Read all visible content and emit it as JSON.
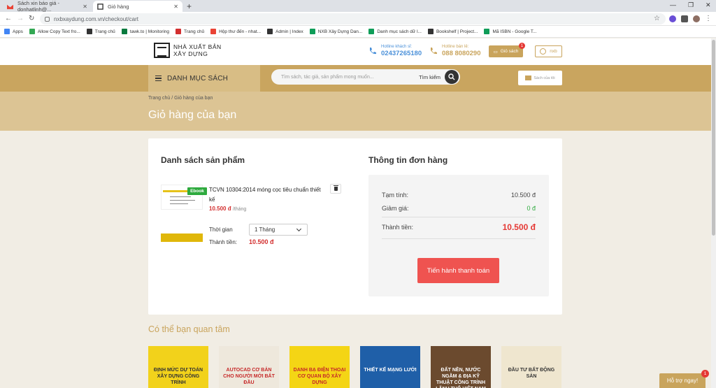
{
  "browser": {
    "tabs": [
      {
        "label": "Sách xin báo giá - donhatlinh@..."
      },
      {
        "label": "Giỏ hàng"
      }
    ],
    "url": "nxbxaydung.com.vn/checkout/cart",
    "bookmarks": [
      "Apps",
      "Allow Copy Text fro...",
      "Trang chủ",
      "tawk.to | Monitoring",
      "Trang chủ",
      "Hộp thư đến - nhat...",
      "Admin | Index",
      "NXB Xây Dựng Dan...",
      "Danh mục sách dữ l...",
      "Bookshelf | Project...",
      "Mã ISBN - Google T..."
    ]
  },
  "header": {
    "logo_line1": "NHÀ XUẤT BẢN",
    "logo_line2": "XÂY DỰNG",
    "hotline1_label": "Hotline khách sỉ:",
    "hotline1_number": "02437265180",
    "hotline2_label": "Hotline bán lẻ:",
    "hotline2_number": "088 8080290",
    "cart_label": "Giỏ sách",
    "cart_count": "1",
    "user_label": "nxb"
  },
  "nav": {
    "menu_label": "DANH MỤC SÁCH",
    "search_placeholder": "Tìm sách, tác giả, sản phẩm mong muốn...",
    "search_label": "Tìm kiếm",
    "bookshelf_label": "Sách của tôi"
  },
  "banner": {
    "breadcrumb": "Trang chủ / Giỏ hàng của bạn",
    "title": "Giỏ hàng của bạn"
  },
  "cart": {
    "heading": "Danh sách sản phẩm",
    "item": {
      "badge": "Ebook",
      "name": "TCVN 10304:2014 móng cọc tiêu chuẩn thiết kế",
      "price": "10.500 đ",
      "price_unit": "/tháng",
      "duration_label": "Thời gian",
      "duration_value": "1 Tháng",
      "subtotal_label": "Thành tiền:",
      "subtotal_value": "10.500 đ"
    }
  },
  "order": {
    "heading": "Thông tin đơn hàng",
    "subtotal_label": "Tạm tính:",
    "subtotal_value": "10.500 đ",
    "discount_label": "Giảm giá:",
    "discount_value": "0 đ",
    "total_label": "Thành tiền:",
    "total_value": "10.500 đ",
    "checkout_label": "Tiến hành thanh toán"
  },
  "suggestions": {
    "heading": "Có thể bạn quan tâm",
    "books": [
      {
        "title": "ĐỊNH MỨC DỰ TOÁN XÂY DỰNG CÔNG TRÌNH",
        "color": "#f2d21b",
        "text_color": "#333"
      },
      {
        "title": "AUTOCAD CƠ BẢN CHO NGƯỜI MỚI BẮT ĐẦU",
        "color": "#eee8dc",
        "text_color": "#c62828"
      },
      {
        "title": "DANH BẠ ĐIỆN THOẠI CƠ QUAN BỘ XÂY DỰNG",
        "color": "#f4d515",
        "text_color": "#c62828"
      },
      {
        "title": "THIẾT KẾ MẠNG LƯỚI",
        "color": "#1f5fa8",
        "text_color": "#ffffff"
      },
      {
        "title": "ĐẤT NỀN, NƯỚC NGẦM & ĐỊA KỸ THUẬT CÔNG TRÌNH LÃNH THỔ VIỆT NAM",
        "color": "#6b4a2e",
        "text_color": "#ffffff"
      },
      {
        "title": "ĐẦU TƯ BẤT ĐỘNG SẢN",
        "color": "#efe6cf",
        "text_color": "#333"
      }
    ]
  },
  "help": {
    "label": "Hỗ trợ ngay!",
    "count": "1"
  },
  "colors": {
    "gold": "#c9a45c",
    "red": "#ef5350",
    "green": "#2eaa3e"
  }
}
